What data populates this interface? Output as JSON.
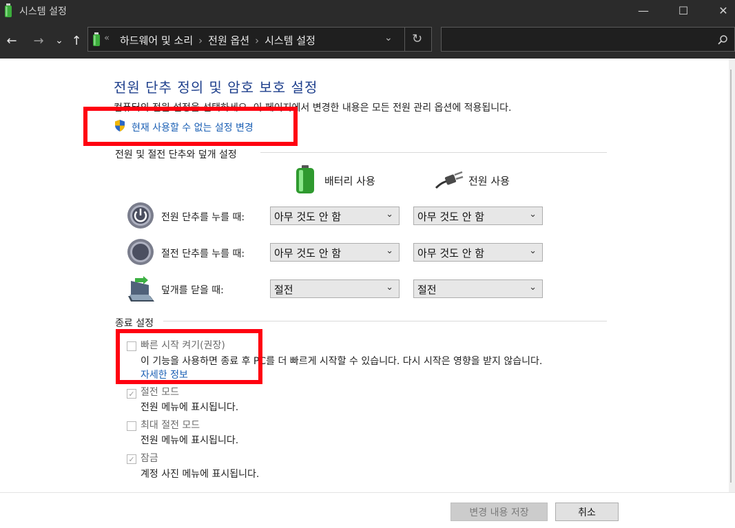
{
  "window": {
    "title": "시스템 설정",
    "controls": [
      "—",
      "☐",
      "✕"
    ]
  },
  "nav": {
    "back": "←",
    "forward": "→",
    "recent": "⌄",
    "up": "↑",
    "breadcrumb_prefix": "«",
    "breadcrumb": [
      "하드웨어 및 소리",
      "전원 옵션",
      "시스템 설정"
    ],
    "dropdown": "⌄",
    "refresh": "↻",
    "search_placeholder": ""
  },
  "main": {
    "heading": "전원 단추 정의 및 암호 보호 설정",
    "description": "컴퓨터의 전원 설정을 선택하세요. 이 페이지에서 변경한 내용은 모든 전원 관리 옵션에 적용됩니다.",
    "change_link": "현재 사용할 수 없는 설정 변경",
    "buttons_section": "전원 및 절전 단추와 덮개 설정",
    "battery_header": "배터리 사용",
    "plugged_header": "전원 사용",
    "rows": [
      {
        "label": "전원 단추를 누를 때:",
        "battery": "아무 것도 안 함",
        "plugged": "아무 것도 안 함"
      },
      {
        "label": "절전 단추를 누를 때:",
        "battery": "아무 것도 안 함",
        "plugged": "아무 것도 안 함"
      },
      {
        "label": "덮개를 닫을 때:",
        "battery": "절전",
        "plugged": "절전"
      }
    ],
    "shutdown_section": "종료 설정",
    "options": [
      {
        "title": "빠른 시작 켜기(권장)",
        "desc": "이 기능을 사용하면 종료 후 PC를 더 빠르게 시작할 수 있습니다. 다시 시작은 영향을 받지 않습니다.",
        "link": "자세한 정보",
        "checked": false
      },
      {
        "title": "절전 모드",
        "desc": "전원 메뉴에 표시됩니다.",
        "checked": true
      },
      {
        "title": "최대 절전 모드",
        "desc": "전원 메뉴에 표시됩니다.",
        "checked": false
      },
      {
        "title": "잠금",
        "desc": "계정 사진 메뉴에 표시됩니다.",
        "checked": true
      }
    ],
    "chevron": "⌄",
    "check_mark": "✓"
  },
  "footer": {
    "save": "변경 내용 저장",
    "cancel": "취소"
  },
  "colors": {
    "heading": "#1e3f8c",
    "link": "#1a5fb4",
    "highlight": "#ff0010",
    "titlebar": "#2b2b2b"
  }
}
